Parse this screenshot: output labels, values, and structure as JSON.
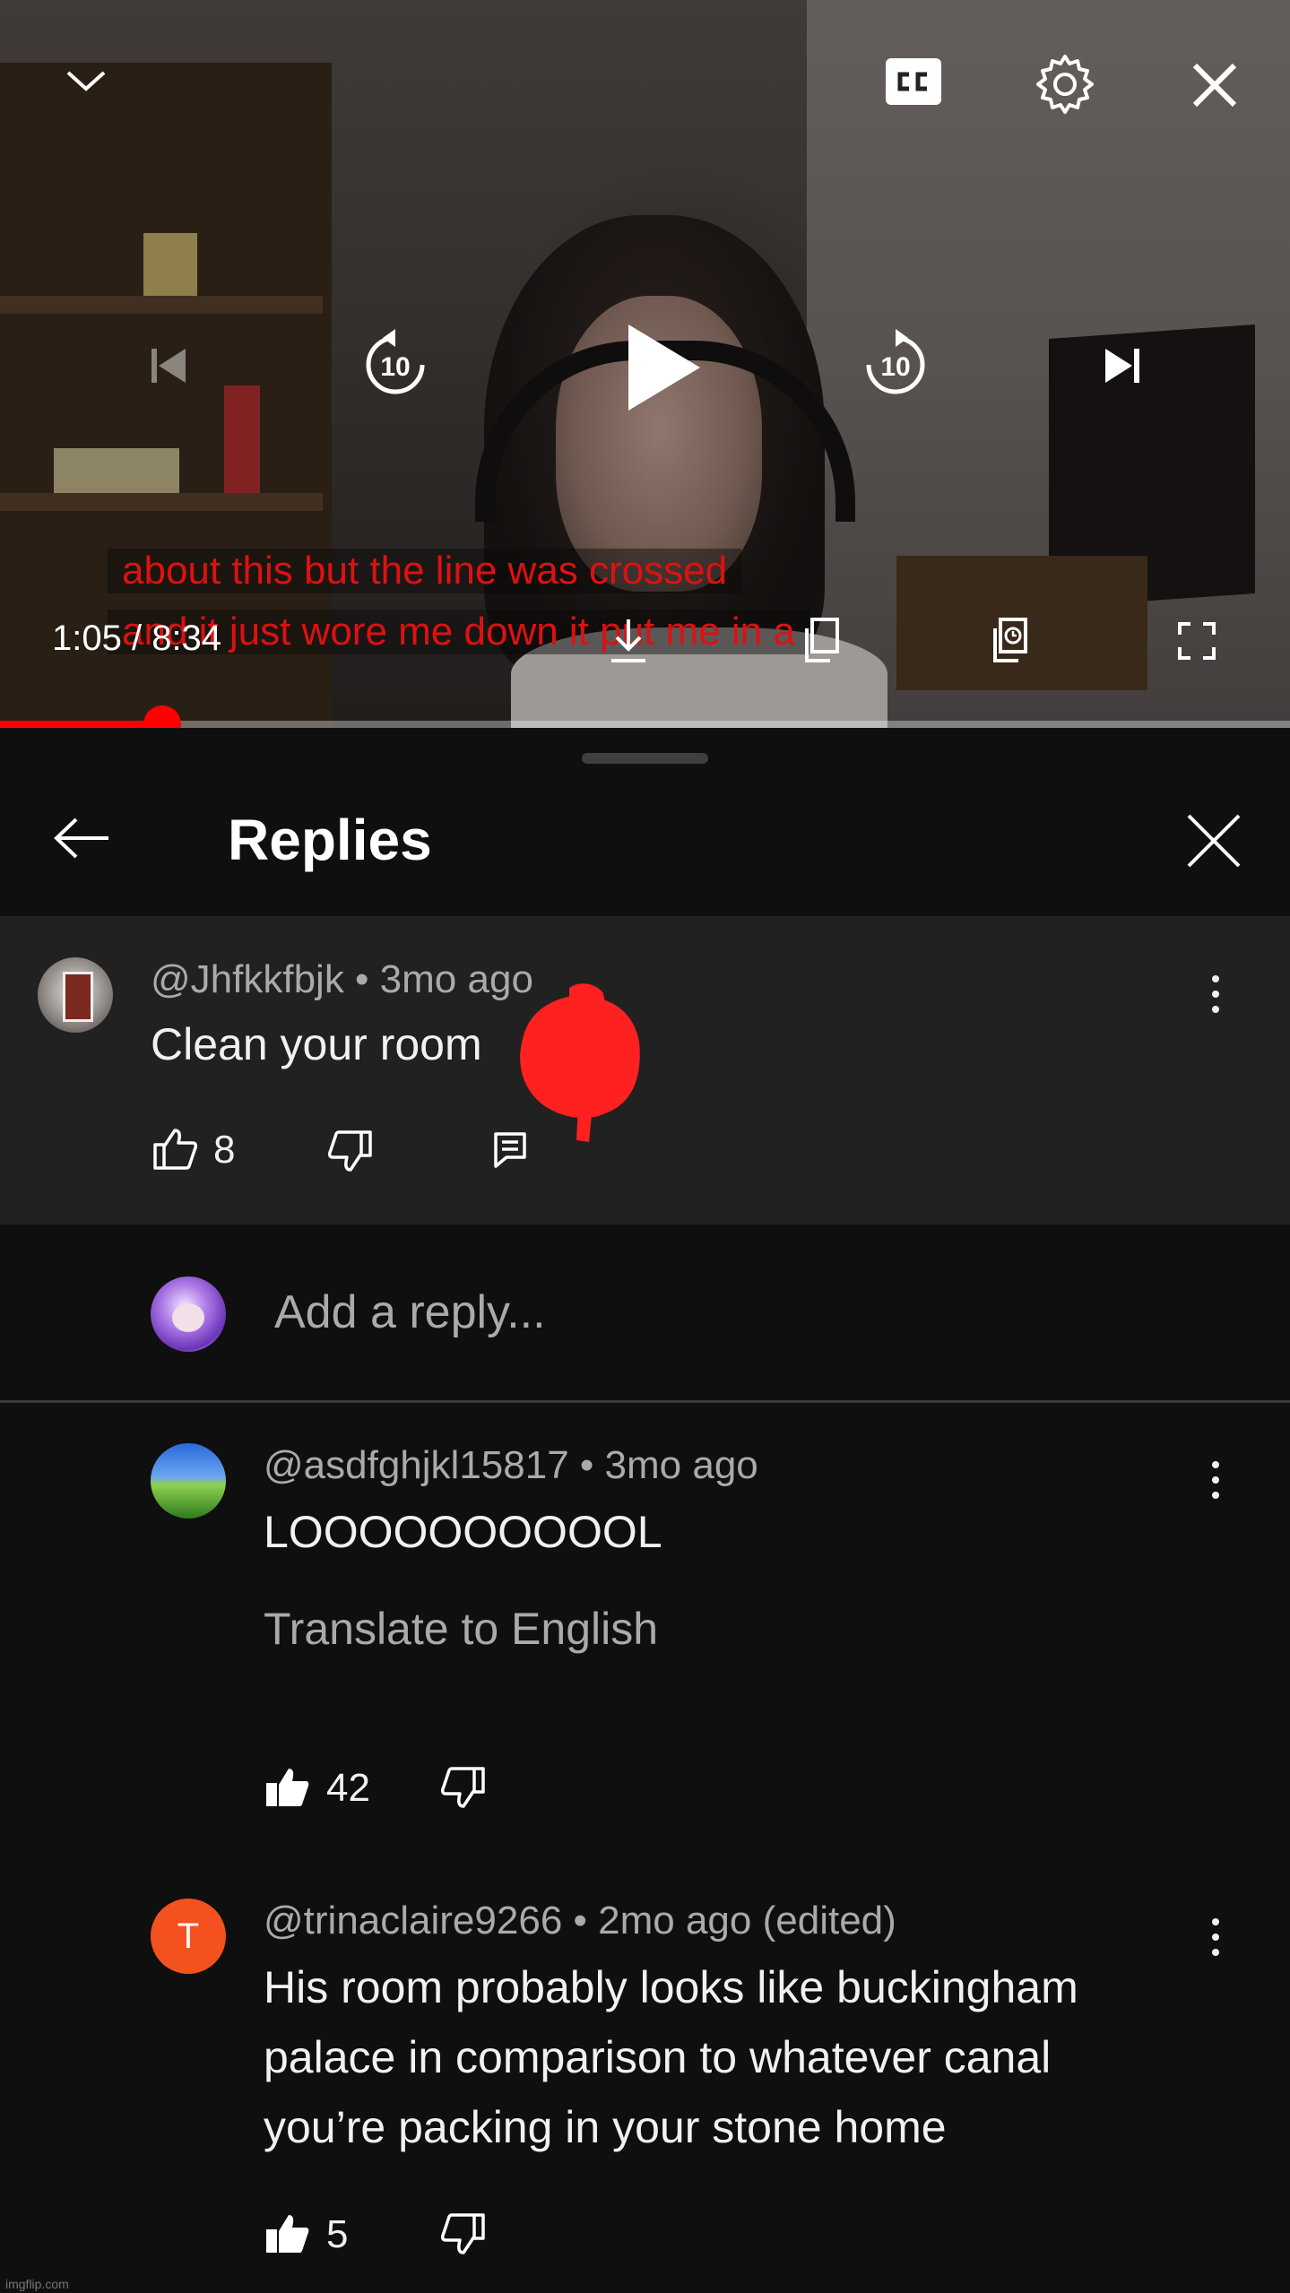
{
  "player": {
    "current_time": "1:05",
    "duration": "8:34",
    "time_label": "1:05 / 8:34",
    "progress": 0.126,
    "caption_lines": [
      "about this but the line was crossed",
      "and it just wore me down it put me in a"
    ],
    "skip_back_label": "10",
    "skip_forward_label": "10",
    "accent_color": "#ff0000"
  },
  "panel": {
    "title": "Replies"
  },
  "parent_comment": {
    "meta": "@Jhfkkfbjk • 3mo ago",
    "text": "Clean your room",
    "likes": "8"
  },
  "reply_box": {
    "placeholder": "Add a reply..."
  },
  "replies": [
    {
      "meta": "@asdfghjkl15817 • 3mo ago",
      "text": "LOOOOOOOOOOL",
      "translate_label": "Translate to English",
      "likes": "42"
    },
    {
      "avatar_letter": "T",
      "avatar_color": "#f4511e",
      "meta": "@trinaclaire9266 • 2mo ago (edited)",
      "text_lines": [
        "His room probably looks like buckingham",
        "palace in comparison to whatever canal",
        "you’re packing in your stone home"
      ],
      "likes": "5"
    }
  ],
  "watermark": "imgflip.com"
}
